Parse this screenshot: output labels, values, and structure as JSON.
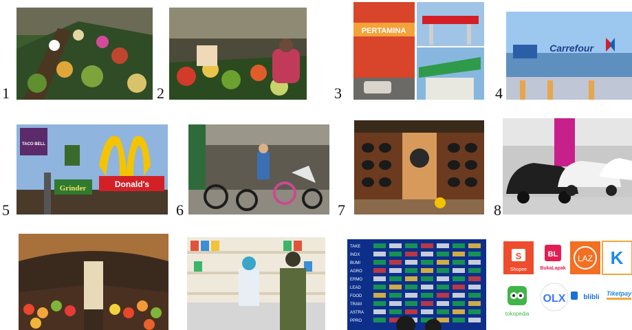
{
  "grid": {
    "numbers": [
      "1",
      "2",
      "3",
      "4",
      "5",
      "6",
      "7",
      "8"
    ]
  },
  "signs": {
    "fuel_station": "PERTAMINA",
    "carrefour": "Carrefour",
    "mcdonalds": "Donald's",
    "grindr": "Grinder",
    "bell": "TACO BELL"
  },
  "market_board": {
    "rows": [
      "TAKE",
      "INDX",
      "BUMI",
      "AGRO",
      "ERMO",
      "LEAD",
      "FOOD",
      "TRAM",
      "ASTRA",
      "PPRO"
    ]
  },
  "ecommerce": {
    "shopee": "Shopee",
    "bukalapak": "BukaLapak",
    "bl": "BL",
    "lazada": "LAZ",
    "tokopedia": "tokopedia",
    "olx": "OLX",
    "blibli": "blibli",
    "tiketpay": "Tiketpay"
  },
  "colors": {
    "shopee": "#ee4d2d",
    "bukalapak": "#e31e52",
    "lazada": "#f36f21",
    "kredivo": "#1e88e5",
    "tokopedia": "#42b549",
    "olx": "#3a77ff",
    "board": "#0d2f8a"
  }
}
